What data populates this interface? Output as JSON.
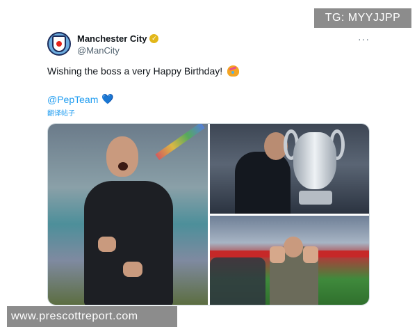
{
  "tweet": {
    "display_name": "Manchester City",
    "handle": "@ManCity",
    "more_icon": "···",
    "text": "Wishing the boss a very Happy Birthday!",
    "mention": "@PepTeam",
    "heart_emoji": "💙",
    "translate_label": "翻译帖子"
  },
  "watermarks": {
    "tg": "TG: MYYJJPP",
    "site": "www.prescottreport.com"
  },
  "colors": {
    "link": "#1d9bf0",
    "verified_badge": "#e2b719",
    "handle_gray": "#536471",
    "watermark_bg": "#8c8c8c"
  }
}
